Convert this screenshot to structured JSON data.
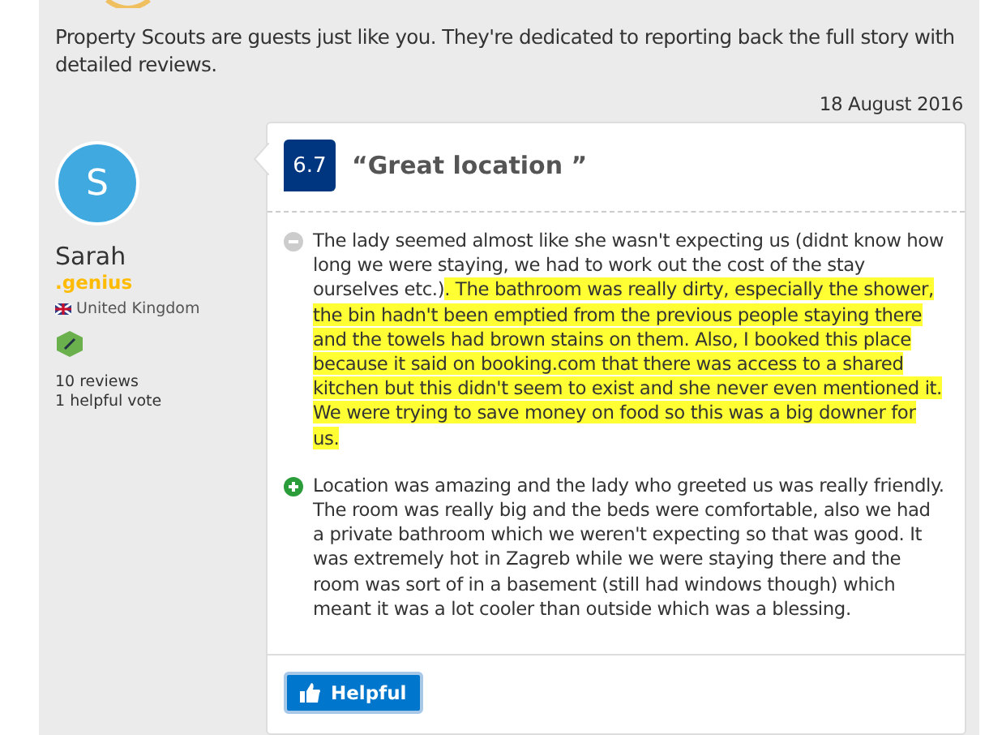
{
  "intro": "Property Scouts are guests just like you. They're dedicated to reporting back the full story with detailed reviews.",
  "date": "18 August 2016",
  "reviewer": {
    "initial": "S",
    "name": "Sarah",
    "badge": ".genius",
    "country": "United Kingdom",
    "reviews": "10 reviews",
    "votes": "1 helpful vote"
  },
  "review": {
    "score": "6.7",
    "title": "“Great location ”",
    "negative": [
      {
        "text": "The lady seemed almost like she wasn't expecting us (didnt know how long we were staying, we had to work out the cost of the stay ourselves etc.)",
        "highlighted": false
      },
      {
        "text": ". The bathroom was really dirty, especially the shower, the bin hadn't been emptied from the previous people staying there and the towels had brown stains on them. Also, I booked this place because it said on booking.com that there was access to a shared kitchen but this didn't seem to exist and she never even mentioned it. We were trying to save money on food so this was a big downer for us.",
        "highlighted": true
      }
    ],
    "positive": "Location was amazing and the lady who greeted us was really friendly. The room was really big and the beds were comfortable, also we had a private bathroom which we weren't expecting so that was good. It was extremely hot in Zagreb while we were staying there and the room was sort of in a basement (still had windows though) which meant it was a lot cooler than outside which was a blessing.",
    "helpful_button": "Helpful"
  }
}
